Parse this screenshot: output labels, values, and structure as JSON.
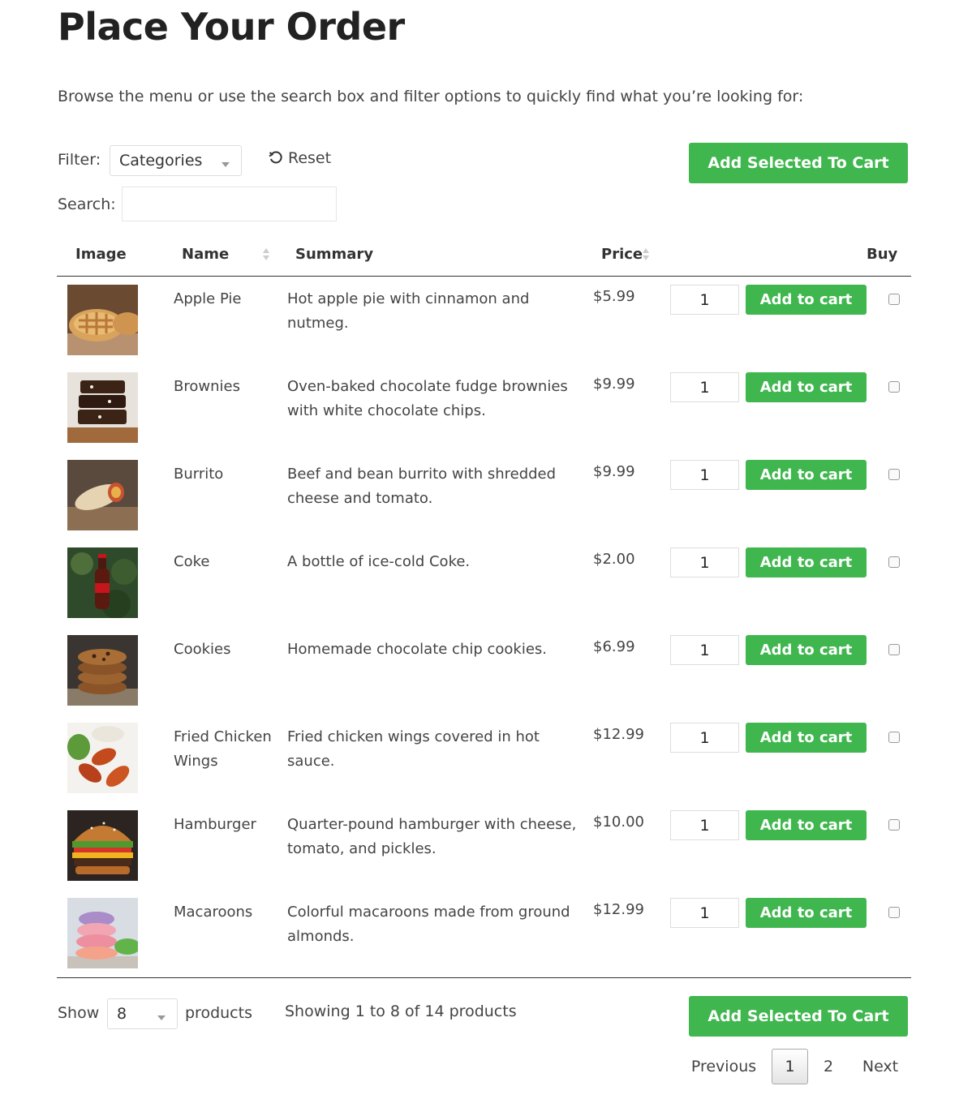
{
  "page": {
    "title": "Place Your Order",
    "intro": "Browse the menu or use the search box and filter options to quickly find what you’re looking for:"
  },
  "toolbar": {
    "filter_label": "Filter:",
    "filter_value": "Categories",
    "reset_label": "Reset",
    "search_label": "Search:",
    "search_value": "",
    "add_selected_label": "Add Selected To Cart"
  },
  "table": {
    "headers": {
      "image": "Image",
      "name": "Name",
      "summary": "Summary",
      "price": "Price",
      "buy": "Buy"
    },
    "add_to_cart_label": "Add to cart",
    "rows": [
      {
        "name": "Apple Pie",
        "summary": "Hot apple pie with cinnamon and nutmeg.",
        "price": "$5.99",
        "qty": "1",
        "image": "apple-pie-photo"
      },
      {
        "name": "Brownies",
        "summary": "Oven-baked chocolate fudge brownies with white chocolate chips.",
        "price": "$9.99",
        "qty": "1",
        "image": "brownies-photo"
      },
      {
        "name": "Burrito",
        "summary": "Beef and bean burrito with shredded cheese and tomato.",
        "price": "$9.99",
        "qty": "1",
        "image": "burrito-photo"
      },
      {
        "name": "Coke",
        "summary": "A bottle of ice-cold Coke.",
        "price": "$2.00",
        "qty": "1",
        "image": "coke-photo"
      },
      {
        "name": "Cookies",
        "summary": "Homemade chocolate chip cookies.",
        "price": "$6.99",
        "qty": "1",
        "image": "cookies-photo"
      },
      {
        "name": "Fried Chicken Wings",
        "summary": "Fried chicken wings covered in hot sauce.",
        "price": "$12.99",
        "qty": "1",
        "image": "chicken-wings-photo"
      },
      {
        "name": "Hamburger",
        "summary": "Quarter-pound hamburger with cheese, tomato, and pickles.",
        "price": "$10.00",
        "qty": "1",
        "image": "hamburger-photo"
      },
      {
        "name": "Macaroons",
        "summary": "Colorful macaroons made from ground almonds.",
        "price": "$12.99",
        "qty": "1",
        "image": "macaroons-photo"
      }
    ]
  },
  "footer": {
    "show_label": "Show",
    "show_value": "8",
    "products_label": "products",
    "showing_text": "Showing 1 to 8 of 14 products",
    "add_selected_label": "Add Selected To Cart",
    "pagination": {
      "previous": "Previous",
      "page1": "1",
      "page2": "2",
      "next": "Next"
    }
  },
  "colors": {
    "accent_green": "#3fb74e",
    "text": "#333333"
  }
}
